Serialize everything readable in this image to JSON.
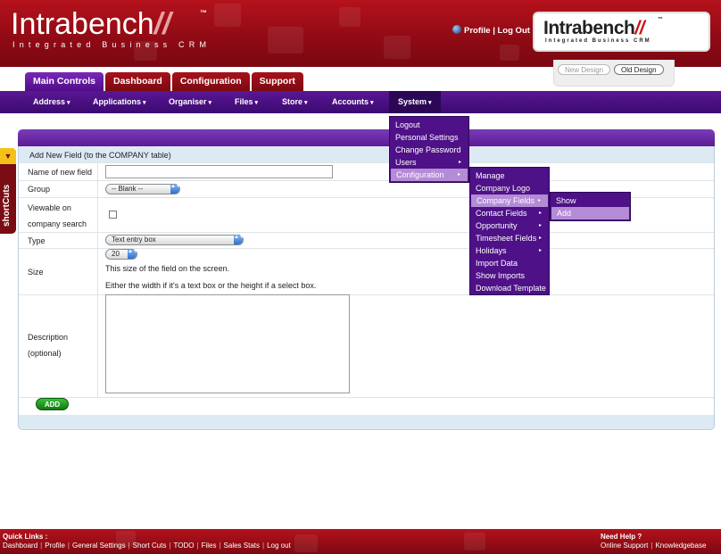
{
  "header": {
    "logo_name": "Intrabench",
    "logo_slash": "//",
    "logo_tm": "™",
    "logo_tagline": "Integrated Business CRM",
    "profile_link": "Profile",
    "separator": " | ",
    "logout_link": "Log Out",
    "brand_name": "Intrabench",
    "brand_slash": "//",
    "brand_tm": "™",
    "brand_tagline": "Integrated Business CRM"
  },
  "design_toggle": {
    "new_label": "New Design",
    "old_label": "Old Design"
  },
  "tabs": [
    {
      "label": "Main Controls"
    },
    {
      "label": "Dashboard"
    },
    {
      "label": "Configuration"
    },
    {
      "label": "Support"
    }
  ],
  "nav": [
    {
      "label": "Address"
    },
    {
      "label": "Applications"
    },
    {
      "label": "Organiser"
    },
    {
      "label": "Files"
    },
    {
      "label": "Store"
    },
    {
      "label": "Accounts"
    },
    {
      "label": "System"
    }
  ],
  "shortcuts": {
    "label": "shortCuts",
    "arrow": "▼"
  },
  "form": {
    "title": "Add New Field (to the COMPANY table)",
    "name_label": "Name of new field",
    "group_label": "Group",
    "group_value": "-- Blank --",
    "viewable_label_1": "Viewable on",
    "viewable_label_2": "company search",
    "type_label": "Type",
    "type_value": "Text entry box",
    "size_label": "Size",
    "size_value": "20",
    "size_hint_1": "This size of the field on the screen.",
    "size_hint_2": "Either the width if it's a text box or the height if a select box.",
    "description_label_1": "Description",
    "description_label_2": "(optional)",
    "add_button": "ADD"
  },
  "system_menu": [
    {
      "label": "Logout"
    },
    {
      "label": "Personal Settings"
    },
    {
      "label": "Change Password"
    },
    {
      "label": "Users"
    },
    {
      "label": "Configuration"
    }
  ],
  "config_menu": [
    {
      "label": "Manage"
    },
    {
      "label": "Company Logo"
    },
    {
      "label": "Company Fields"
    },
    {
      "label": "Contact Fields"
    },
    {
      "label": "Opportunity"
    },
    {
      "label": "Timesheet Fields"
    },
    {
      "label": "Holidays"
    },
    {
      "label": "Import Data"
    },
    {
      "label": "Show Imports"
    },
    {
      "label": "Download Template"
    }
  ],
  "fields_menu": [
    {
      "label": "Show"
    },
    {
      "label": "Add"
    }
  ],
  "footer": {
    "quick_links_title": "Quick Links :",
    "quick_links": [
      "Dashboard",
      "Profile",
      "General Settings",
      "Short Cuts",
      "TODO",
      "Files",
      "Sales Stats",
      "Log out"
    ],
    "help_title": "Need Help ?",
    "help_links": [
      "Online Support",
      "Knowledgebase"
    ]
  },
  "colors": {
    "header_red": "#b5121c",
    "nav_purple": "#4e1187",
    "tab_active": "#5a1995",
    "add_green": "#1a8f1a"
  },
  "glyphs": {
    "caret_down": "▾",
    "caret_right": "▸",
    "select_arrows": "▲▼"
  }
}
